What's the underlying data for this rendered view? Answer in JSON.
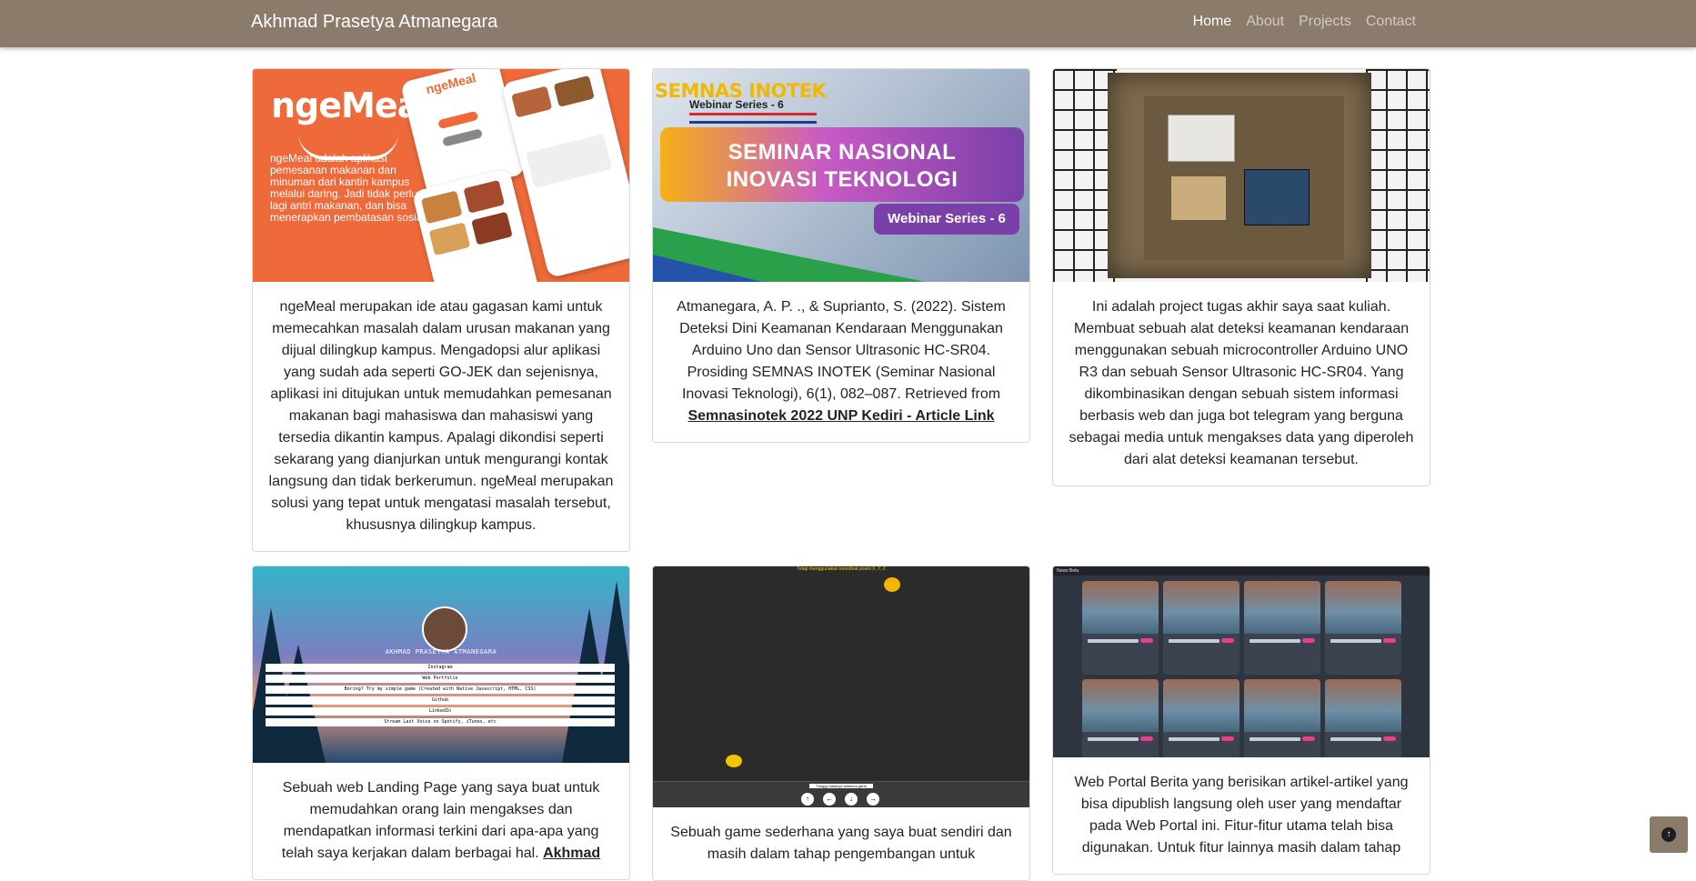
{
  "navbar": {
    "brand": "Akhmad Prasetya Atmanegara",
    "links": [
      {
        "label": "Home",
        "active": true
      },
      {
        "label": "About",
        "active": false
      },
      {
        "label": "Projects",
        "active": false
      },
      {
        "label": "Contact",
        "active": false
      }
    ]
  },
  "cards": [
    {
      "thumb": {
        "logo": "ngeMeal",
        "phone_logo": "ngeMeal",
        "description": "ngeMeal adalah aplikasi pemesanan makanan dan minuman dari kantin kampus melalui daring. Jadi tidak perlu lagi antri makanan, dan bisa menerapkan pembatasan sosial"
      },
      "text": "ngeMeal merupakan ide atau gagasan kami untuk memecahkan masalah dalam urusan makanan yang dijual dilingkup kampus. Mengadopsi alur aplikasi yang sudah ada seperti GO-JEK dan sejenisnya, aplikasi ini ditujukan untuk memudahkan pemesanan makanan bagi mahasiswa dan mahasiswi yang tersedia dikantin kampus. Apalagi dikondisi seperti sekarang yang dianjurkan untuk mengurangi kontak langsung dan tidak berkerumun. ngeMeal merupakan solusi yang tepat untuk mengatasi masalah tersebut, khususnya dilingkup kampus."
    },
    {
      "thumb": {
        "top_title": "SEMNAS INOTEK",
        "top_subtitle": "Webinar Series - 6",
        "line1": "SEMINAR NASIONAL",
        "line2": "INOVASI TEKNOLOGI",
        "pill": "Webinar Series - 6"
      },
      "text": "Atmanegara, A. P. ., & Suprianto, S. (2022). Sistem Deteksi Dini Keamanan Kendaraan Menggunakan Arduino Uno dan Sensor Ultrasonic HC-SR04. Prosiding SEMNAS INOTEK (Seminar Nasional Inovasi Teknologi), 6(1), 082–087. Retrieved from",
      "link": "Semnasinotek 2022 UNP Kediri - Article Link"
    },
    {
      "text": "Ini adalah project tugas akhir saya saat kuliah. Membuat sebuah alat deteksi keamanan kendaraan menggunakan sebuah microcontroller Arduino UNO R3 dan sebuah Sensor Ultrasonic HC-SR04. Yang dikombinasikan dengan sebuah sistem informasi berbasis web dan juga bot telegram yang berguna sebagai media untuk mengakses data yang diperoleh dari alat deteksi keamanan tersebut."
    },
    {
      "thumb": {
        "name": "AKHMAD PRASETYA ATMANEGARA",
        "links": [
          "Instagram",
          "Web Portfolio",
          "Boring? Try my simple game (Created with Native Javascript, HTML, CSS)",
          "Github",
          "LinkedIn",
          "Stream Last Voice on Spotify, iTunes, etc"
        ]
      },
      "text": "Sebuah web Landing Page yang saya buat untuk memudahkan orang lain mengakses dan mendapatkan informasi terkini dari apa-apa yang telah saya kerjakan dalam berbagai hal.",
      "link": "Akhmad"
    },
    {
      "thumb": {
        "top_text": "Tetap menggunakan koordinat posisi X, Y, Z",
        "label": "Tunggu hasilnya sebelum ganti",
        "buttons": [
          "↑",
          "←",
          "↓",
          "→"
        ]
      },
      "text": "Sebuah game sederhana yang saya buat sendiri dan masih dalam tahap pengembangan untuk"
    },
    {
      "thumb": {
        "nav_brand": "News Beta"
      },
      "text": "Web Portal Berita yang berisikan artikel-artikel yang bisa dipublish langsung oleh user yang mendaftar pada Web Portal ini. Fitur-fitur utama telah bisa digunakan. Untuk fitur lainnya masih dalam tahap"
    }
  ],
  "back_to_top": {
    "icon": "arrow-up-circle-icon"
  }
}
